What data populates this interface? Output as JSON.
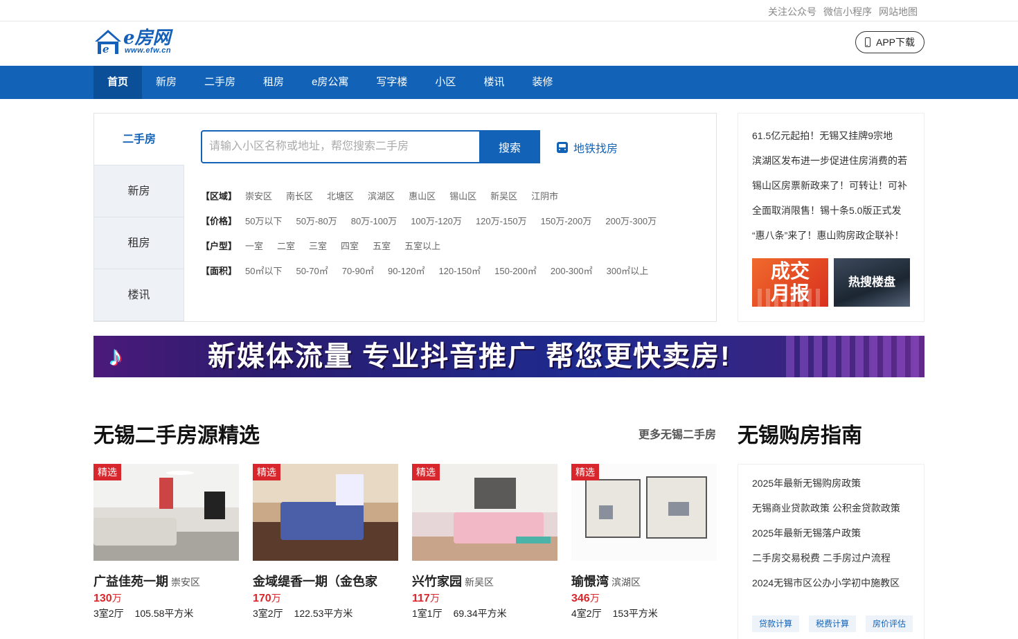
{
  "toplinks": [
    "关注公众号",
    "微信小程序",
    "网站地图"
  ],
  "logo": {
    "text": "e房网",
    "sub": "www.efw.cn"
  },
  "app_download": "APP下载",
  "nav": [
    "首页",
    "新房",
    "二手房",
    "租房",
    "e房公寓",
    "写字楼",
    "小区",
    "楼讯",
    "装修"
  ],
  "search": {
    "tabs": [
      "二手房",
      "新房",
      "租房",
      "楼讯"
    ],
    "placeholder": "请输入小区名称或地址，帮您搜索二手房",
    "button": "搜索",
    "subway": "地铁找房",
    "filters": [
      {
        "label": "【区域】",
        "options": [
          "崇安区",
          "南长区",
          "北塘区",
          "滨湖区",
          "惠山区",
          "锡山区",
          "新吴区",
          "江阴市"
        ]
      },
      {
        "label": "【价格】",
        "options": [
          "50万以下",
          "50万-80万",
          "80万-100万",
          "100万-120万",
          "120万-150万",
          "150万-200万",
          "200万-300万"
        ]
      },
      {
        "label": "【户型】",
        "options": [
          "一室",
          "二室",
          "三室",
          "四室",
          "五室",
          "五室以上"
        ]
      },
      {
        "label": "【面积】",
        "options": [
          "50㎡以下",
          "50-70㎡",
          "70-90㎡",
          "90-120㎡",
          "120-150㎡",
          "150-200㎡",
          "200-300㎡",
          "300㎡以上"
        ]
      }
    ]
  },
  "news": [
    "61.5亿元起拍！无锡又挂牌9宗地",
    "滨湖区发布进一步促进住房消费的若",
    "锡山区房票新政来了！可转让！可补",
    "全面取消限售！锡十条5.0版正式发",
    "“惠八条”来了！惠山购房政企联补！"
  ],
  "promo": {
    "report_line1": "成交",
    "report_line2": "月报",
    "hot": "热搜楼盘"
  },
  "banner": {
    "text": "新媒体流量 专业抖音推广 帮您更快卖房!"
  },
  "section": {
    "title": "无锡二手房源精选",
    "more": "更多无锡二手房"
  },
  "listings": [
    {
      "tag": "精选",
      "name": "广益佳苑一期",
      "district": "崇安区",
      "price": "130",
      "unit": "万",
      "layout": "3室2厅",
      "area": "105.58平方米"
    },
    {
      "tag": "精选",
      "name": "金域缇香一期（金色家",
      "district": "",
      "price": "170",
      "unit": "万",
      "layout": "3室2厅",
      "area": "122.53平方米"
    },
    {
      "tag": "精选",
      "name": "兴竹家园",
      "district": "新吴区",
      "price": "117",
      "unit": "万",
      "layout": "1室1厅",
      "area": "69.34平方米"
    },
    {
      "tag": "精选",
      "name": "瑜憬湾",
      "district": "滨湖区",
      "price": "346",
      "unit": "万",
      "layout": "4室2厅",
      "area": "153平方米"
    }
  ],
  "guide": {
    "title": "无锡购房指南",
    "items": [
      "2025年最新无锡购房政策",
      "无锡商业贷款政策 公积金贷款政策",
      "2025年最新无锡落户政策",
      "二手房交易税费 二手房过户流程",
      "2024无锡市区公办小学初中施教区"
    ],
    "buttons": [
      "贷款计算",
      "税费计算",
      "房价评估"
    ]
  }
}
